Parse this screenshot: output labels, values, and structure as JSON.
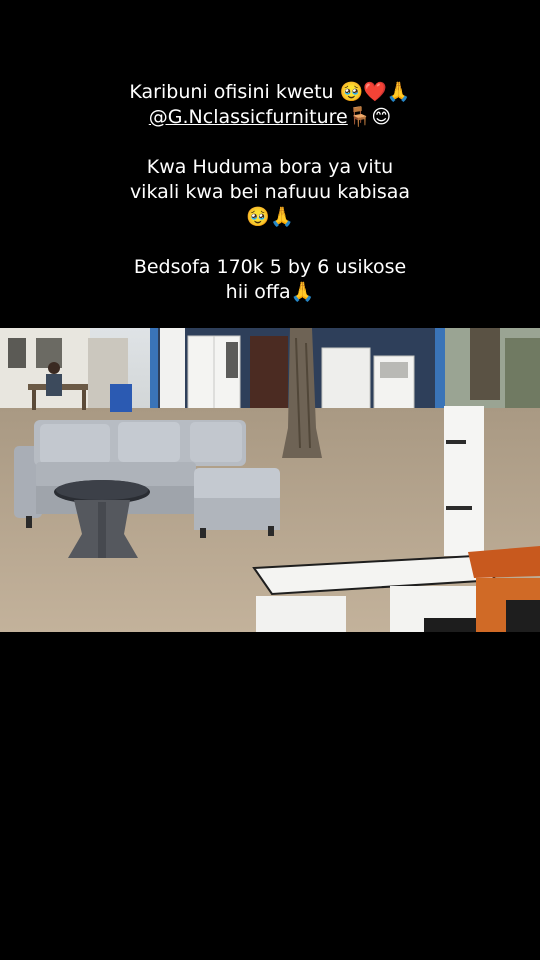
{
  "caption": {
    "line1": "Karibuni ofisini kwetu 🥹❤️🙏",
    "handle": "@G.Nclassicfurniture",
    "handle_emoji": "🪑😊",
    "line3": "Kwa Huduma bora ya vitu",
    "line4": "vikali kwa bei nafuuu kabisaa",
    "line5": "🥹🙏",
    "line6": "Bedsofa 170k 5 by 6 usikose",
    "line7": "hii offa🙏"
  },
  "colors": {
    "background": "#000000",
    "text": "#ffffff",
    "sofa": "#b7bcc3",
    "ground": "#b9a791"
  },
  "photo": {
    "subjects": [
      "grey-l-shaped-sofa-icon",
      "round-marble-coffee-table-icon",
      "white-tv-stand-icon",
      "orange-cabinet-icon",
      "white-wardrobe-icon",
      "tree-trunk-icon",
      "worker-icon"
    ]
  }
}
